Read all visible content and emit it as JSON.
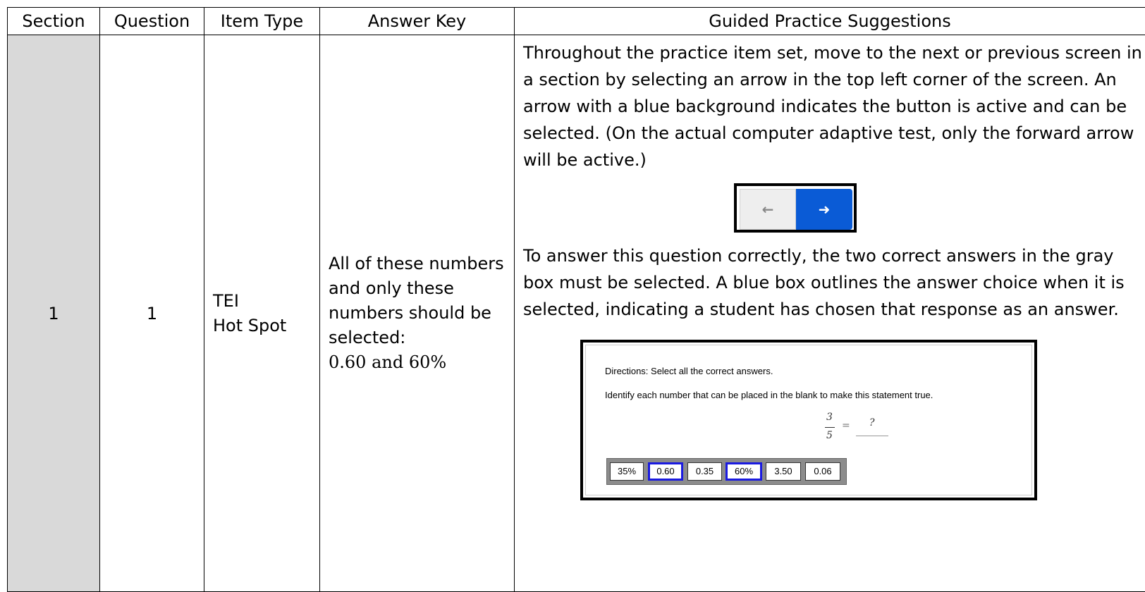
{
  "headers": {
    "section": "Section",
    "question": "Question",
    "item_type": "Item Type",
    "answer_key": "Answer Key",
    "guided": "Guided Practice Suggestions"
  },
  "row": {
    "section": "1",
    "question": "1",
    "item_type_line1": "TEI",
    "item_type_line2": "Hot Spot",
    "answer_key_text": "All of these numbers and only these numbers should be selected:",
    "answer_key_values": "0.60 and 60%",
    "guided_para1": "Throughout the practice item set, move to the next or previous screen in a section by selecting an arrow in the top left corner of the screen.  An arrow with a blue background indicates the button is active and can be selected. (On the actual computer adaptive test, only the forward arrow will be active.)",
    "guided_para2": "To answer this question correctly, the two correct answers in the gray box must be selected.  A blue box outlines the answer choice when it is selected, indicating a student has chosen that response as an answer."
  },
  "nav": {
    "prev_icon": "arrow-left-icon",
    "next_icon": "arrow-right-icon",
    "active_color": "#0a5bd6"
  },
  "item": {
    "directions": "Directions: Select all the correct answers.",
    "prompt": "Identify each number that can be placed in the blank to make this statement true.",
    "numerator": "3",
    "denominator": "5",
    "equals": "=",
    "placeholder": "?",
    "choices": [
      {
        "label": "35%",
        "selected": false
      },
      {
        "label": "0.60",
        "selected": true
      },
      {
        "label": "0.35",
        "selected": false
      },
      {
        "label": "60%",
        "selected": true
      },
      {
        "label": "3.50",
        "selected": false
      },
      {
        "label": "0.06",
        "selected": false
      }
    ],
    "selected_border_color": "#1a1ae0"
  }
}
